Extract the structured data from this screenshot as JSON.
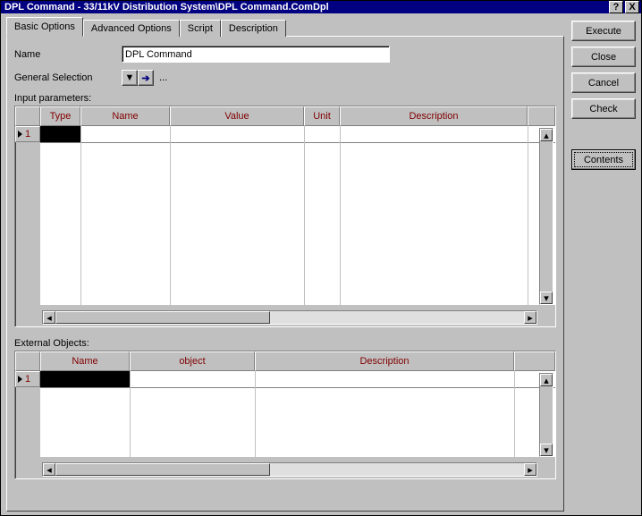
{
  "window": {
    "title": "DPL Command - 33/11kV Distribution System\\DPL Command.ComDpl"
  },
  "tabs": {
    "t0": "Basic Options",
    "t1": "Advanced Options",
    "t2": "Script",
    "t3": "Description"
  },
  "form": {
    "name_label": "Name",
    "name_value": "DPL Command",
    "gensel_label": "General Selection",
    "gensel_dots": "...",
    "input_params_label": "Input parameters:",
    "external_objs_label": "External Objects:"
  },
  "grid1": {
    "headers": {
      "type": "Type",
      "name": "Name",
      "value": "Value",
      "unit": "Unit",
      "desc": "Description"
    },
    "row1": "1"
  },
  "grid2": {
    "headers": {
      "name": "Name",
      "object": "object",
      "desc": "Description"
    },
    "row1": "1"
  },
  "buttons": {
    "execute": "Execute",
    "close": "Close",
    "cancel": "Cancel",
    "check": "Check",
    "contents": "Contents"
  },
  "glyphs": {
    "help": "?",
    "close": "X",
    "down": "▼",
    "right": "➔",
    "up_s": "▴",
    "down_s": "▾",
    "left_s": "◂",
    "right_s": "▸"
  }
}
